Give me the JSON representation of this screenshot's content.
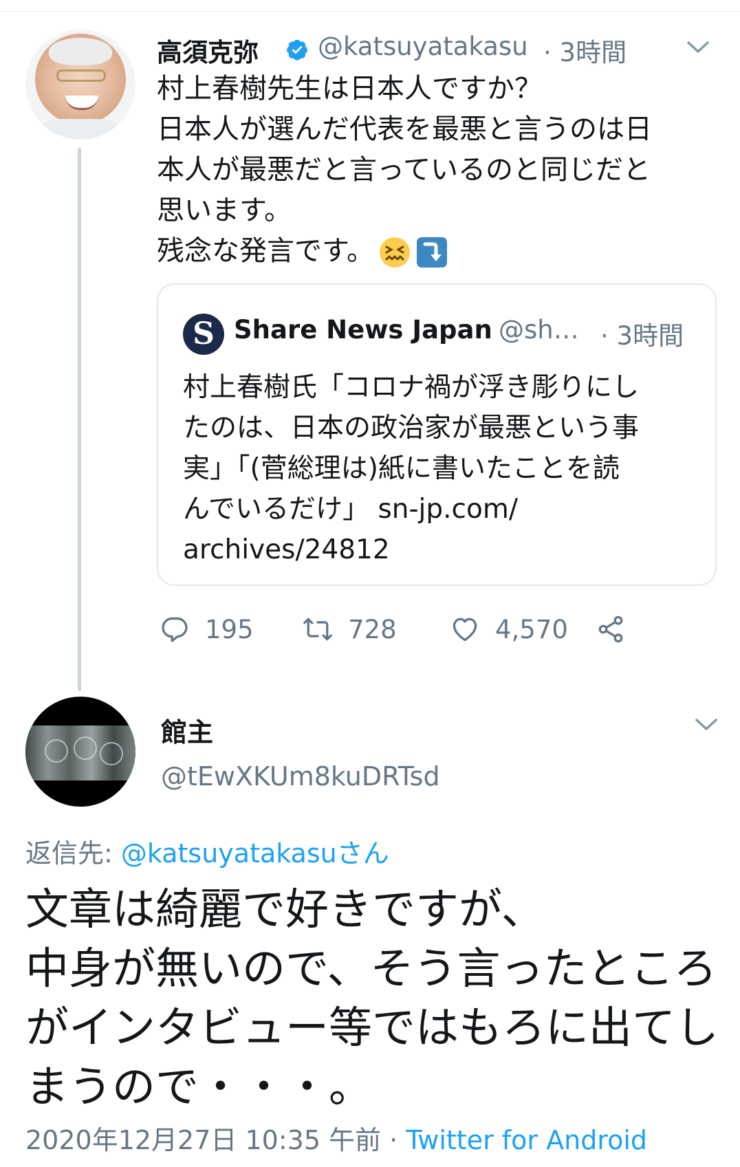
{
  "tweet1": {
    "author_name": "高須克弥",
    "handle": "@katsuyatakasu",
    "time": "· 3時間",
    "lines": [
      "村上春樹先生は日本人ですか？",
      "日本人が選んだ代表を最悪と言うのは日",
      "本人が最悪だと言っているのと同じだと",
      "思います。",
      "残念な発言です。"
    ],
    "emojis": [
      "confounded-face",
      "arrow-down-curved"
    ],
    "quote": {
      "source_name": "Share News Japan",
      "source_handle": "@sh…",
      "time": "· 3時間",
      "lines": [
        "村上春樹氏「コロナ禍が浮き彫りにし",
        "たのは、日本の政治家が最悪という事",
        "実」「(菅総理は)紙に書いたことを読",
        "んでいるだけ」 sn-jp.com/",
        "archives/24812"
      ]
    },
    "stats": {
      "replies": "195",
      "retweets": "728",
      "likes": "4,570"
    }
  },
  "tweet2": {
    "author_name": "館主",
    "handle": "@tEwXKUm8kuDRTsd",
    "replying_label": "返信先: ",
    "replying_to": "@katsuyatakasuさん",
    "lines": [
      "文章は綺麗で好きですが、",
      "中身が無いので、そう言ったところ",
      "がインタビュー等ではもろに出てし",
      "まうので・・・。"
    ],
    "timestamp": "2020年12月27日 10:35 午前",
    "separator": " · ",
    "source": "Twitter for Android"
  },
  "colors": {
    "text": "#14171a",
    "secondary": "#657786",
    "link": "#1da1f2",
    "border": "#e1e8ed"
  }
}
